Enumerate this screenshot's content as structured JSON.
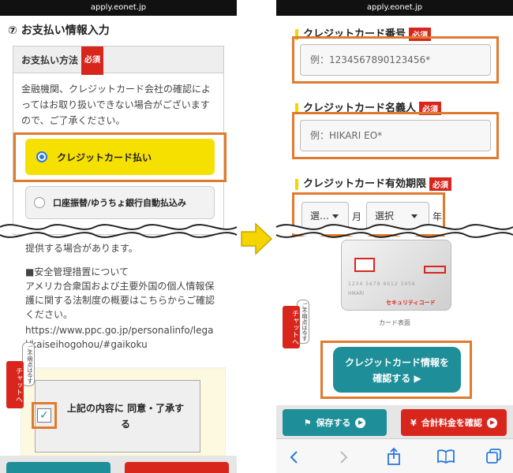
{
  "left": {
    "url": "apply.eonet.jp",
    "section_title": "⑦ お支払い情報入力",
    "payment_label": "お支払い方法",
    "required": "必須",
    "notice": "金融機関、クレジットカード会社の確認によってはお取り扱いできない場合がございますので、ご了承ください。",
    "option_credit": "クレジットカード払い",
    "option_bank": "口座振替/ゆうちょ銀行自動払込み",
    "provide_text": "提供する場合があります。",
    "security_title": "■安全管理措置について",
    "security_body": "アメリカ合衆国および主要外国の個人情報保護に関する法制度の概要はこちらからご確認ください。",
    "security_url": "https://www.ppc.go.jp/personalinfo/legal/kaiseihogohou/#gaikoku",
    "agree_label": "上記の内容に 同意・了承する",
    "chat_label": "チャットへ",
    "chat_note": "ご不明点は今すぐ"
  },
  "right": {
    "url": "apply.eonet.jp",
    "card_number_label": "クレジットカード番号",
    "card_number_placeholder": "例：1234567890123456*",
    "card_name_label": "クレジットカード名義人",
    "card_name_placeholder": "例：HIKARI EO*",
    "expiry_label": "クレジットカード有効期限",
    "required": "必須",
    "month_select": "選…",
    "month_unit": "月",
    "year_select": "選択",
    "year_unit": "年",
    "card_security_code": "セキュリティコード",
    "card_caption": "カード表面",
    "card_digits": "1234 5678 9012 3456",
    "card_holder": "HIKARI",
    "confirm_line1": "クレジットカード情報を",
    "confirm_line2": "確認する",
    "save_button": "保存する",
    "total_button": "合計料金を確認",
    "chat_label": "チャットへ",
    "chat_note": "ご不明点は今すぐ"
  },
  "colors": {
    "accent_orange": "#e07a2e",
    "teal": "#1e8f99",
    "red": "#d9261c",
    "yellow": "#f5d400",
    "safari_blue": "#2a78d8"
  },
  "icons": [
    "radio-selected-icon",
    "radio-empty-icon",
    "checkbox-checked-icon",
    "arrow-right-icon",
    "flag-icon",
    "yen-icon",
    "safari-back-icon",
    "safari-forward-icon",
    "share-icon",
    "bookmarks-icon",
    "tabs-icon"
  ]
}
